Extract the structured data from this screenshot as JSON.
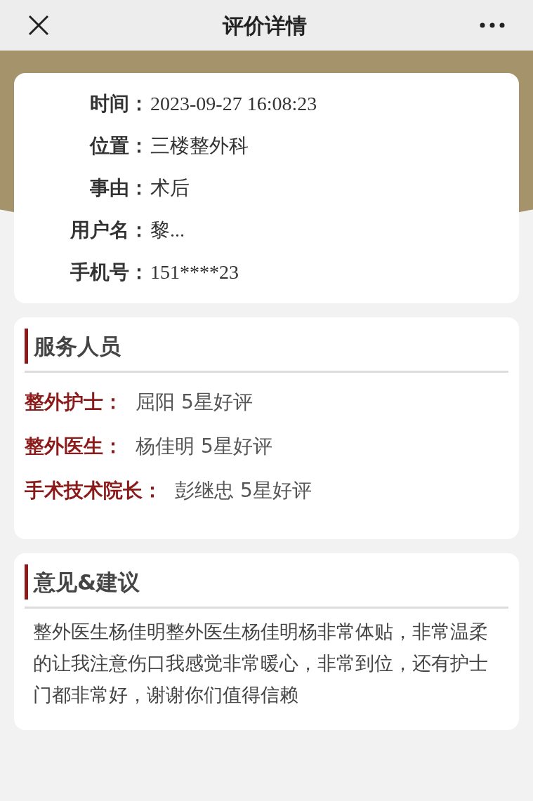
{
  "nav": {
    "title": "评价详情"
  },
  "info": [
    {
      "label": "时间：",
      "value": "2023-09-27 16:08:23"
    },
    {
      "label": "位置：",
      "value": "三楼整外科"
    },
    {
      "label": "事由：",
      "value": "术后"
    },
    {
      "label": "用户名：",
      "value": "黎..."
    },
    {
      "label": "手机号：",
      "value": "151****23"
    }
  ],
  "staff": {
    "title": "服务人员",
    "rows": [
      {
        "role": "整外护士：",
        "value": "屈阳 5星好评"
      },
      {
        "role": "整外医生：",
        "value": "杨佳明 5星好评"
      },
      {
        "role": "手术技术院长：",
        "value": "彭继忠 5星好评"
      }
    ]
  },
  "feedback": {
    "title": "意见&建议",
    "text": "整外医生杨佳明整外医生杨佳明杨非常体贴，非常温柔的让我注意伤口我感觉非常暖心，非常到位，还有护士门都非常好，谢谢你们值得信赖"
  }
}
